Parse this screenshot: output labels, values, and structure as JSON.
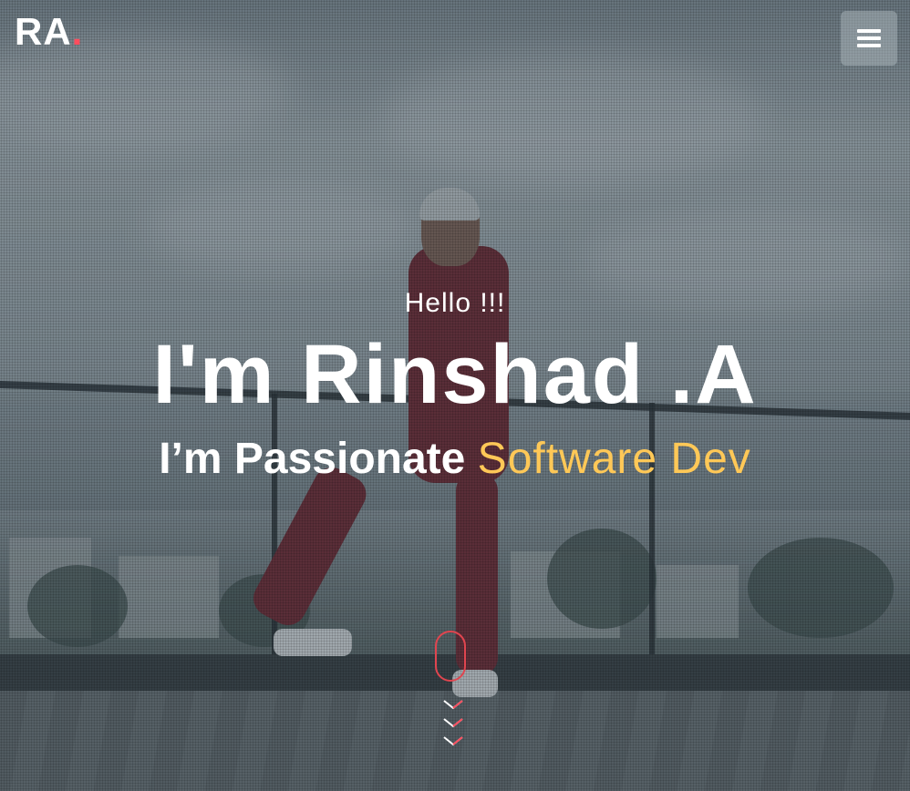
{
  "header": {
    "logo_text": "RA",
    "logo_dot": ".",
    "menu_icon": "hamburger-menu-icon"
  },
  "hero": {
    "greeting": "Hello !!!",
    "name": "I'm Rinshad .A",
    "tagline_prefix": "I’m Passionate",
    "tagline_role": "Software Dev"
  },
  "scroll_indicator": {
    "icon": "scroll-mouse-icon",
    "chevron_icon": "chevron-down-icon"
  },
  "colors": {
    "accent": "#ff4d5e",
    "role_highlight": "#ffc857",
    "text": "#ffffff"
  }
}
